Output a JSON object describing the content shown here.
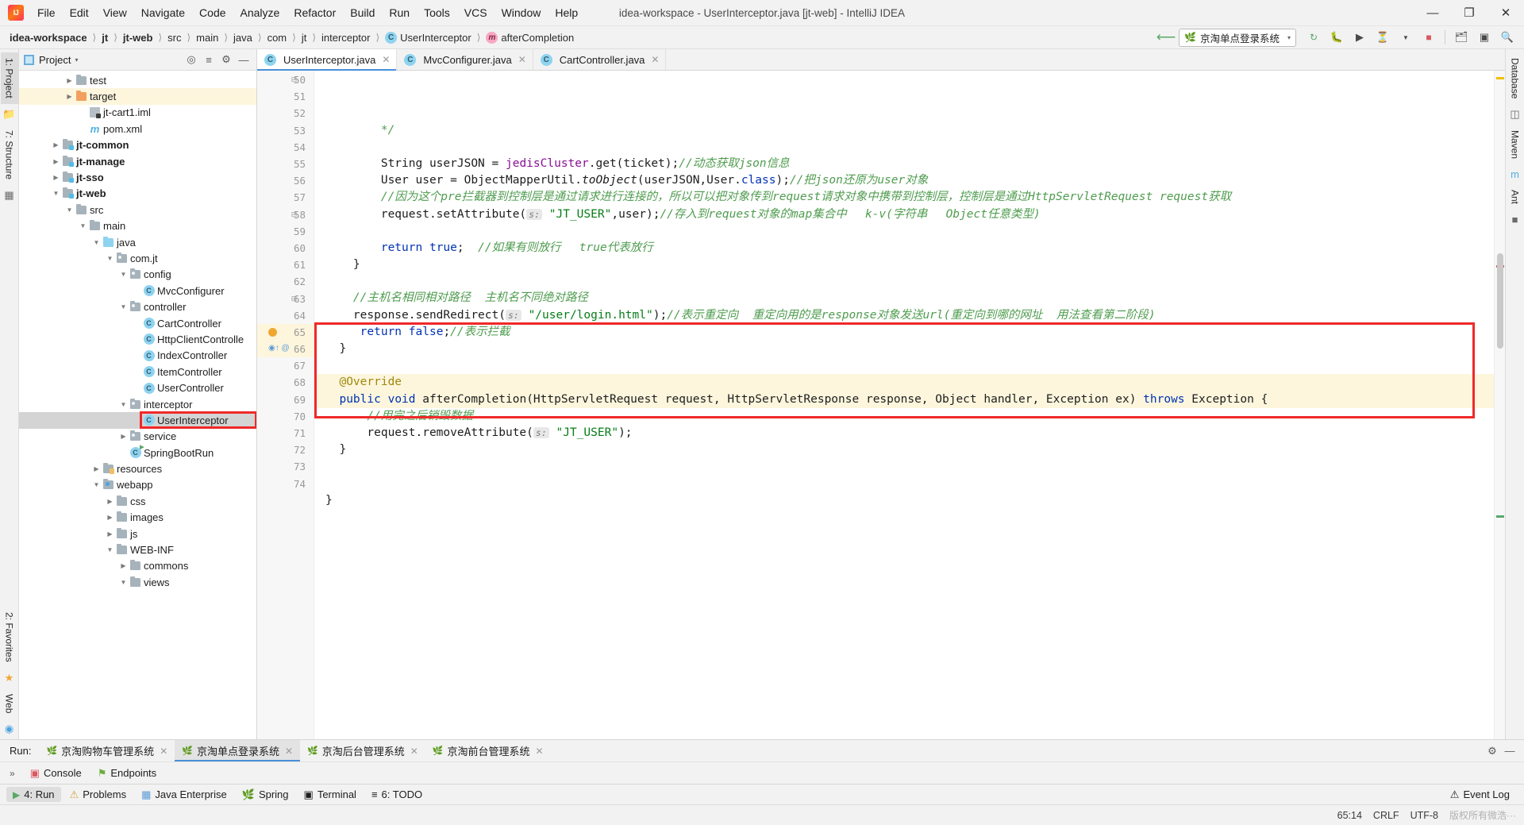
{
  "window": {
    "title": "idea-workspace - UserInterceptor.java [jt-web] - IntelliJ IDEA",
    "minimize": "—",
    "maximize": "❐",
    "close": "✕"
  },
  "menu": [
    {
      "label": "File"
    },
    {
      "label": "Edit"
    },
    {
      "label": "View"
    },
    {
      "label": "Navigate"
    },
    {
      "label": "Code"
    },
    {
      "label": "Analyze"
    },
    {
      "label": "Refactor"
    },
    {
      "label": "Build"
    },
    {
      "label": "Run"
    },
    {
      "label": "Tools"
    },
    {
      "label": "VCS"
    },
    {
      "label": "Window"
    },
    {
      "label": "Help"
    }
  ],
  "breadcrumb": [
    {
      "label": "idea-workspace",
      "bold": true,
      "icon": ""
    },
    {
      "label": "jt",
      "bold": true,
      "icon": ""
    },
    {
      "label": "jt-web",
      "bold": true,
      "icon": ""
    },
    {
      "label": "src",
      "bold": false,
      "icon": ""
    },
    {
      "label": "main",
      "bold": false,
      "icon": ""
    },
    {
      "label": "java",
      "bold": false,
      "icon": ""
    },
    {
      "label": "com",
      "bold": false,
      "icon": ""
    },
    {
      "label": "jt",
      "bold": false,
      "icon": ""
    },
    {
      "label": "interceptor",
      "bold": false,
      "icon": ""
    },
    {
      "label": "UserInterceptor",
      "bold": false,
      "icon": "class-icon"
    },
    {
      "label": "afterCompletion",
      "bold": false,
      "icon": "method-icon"
    }
  ],
  "toolbar": {
    "run_config": "京淘单点登录系统",
    "run_config_caret": "▾",
    "icons": [
      "build-icon",
      "run-icon",
      "debug-icon",
      "coverage-icon",
      "profiler-icon",
      "stop-icon",
      "project-structure-icon",
      "terminal-icon",
      "search-everywhere-icon"
    ]
  },
  "project_panel": {
    "title": "Project",
    "caret": "▾",
    "actions": [
      "locate-icon",
      "collapse-all-icon",
      "settings-icon",
      "hide-icon"
    ],
    "tree": [
      {
        "label": "test",
        "depth": 3,
        "twisty": "▶",
        "icon": "folder",
        "bold": false,
        "state": ""
      },
      {
        "label": "target",
        "depth": 3,
        "twisty": "▶",
        "icon": "folder-orange",
        "bold": false,
        "state": "hl"
      },
      {
        "label": "jt-cart1.iml",
        "depth": 4,
        "twisty": "",
        "icon": "iml",
        "bold": false,
        "state": ""
      },
      {
        "label": "pom.xml",
        "depth": 4,
        "twisty": "",
        "icon": "maven",
        "bold": false,
        "state": ""
      },
      {
        "label": "jt-common",
        "depth": 2,
        "twisty": "▶",
        "icon": "module",
        "bold": true,
        "state": ""
      },
      {
        "label": "jt-manage",
        "depth": 2,
        "twisty": "▶",
        "icon": "module",
        "bold": true,
        "state": ""
      },
      {
        "label": "jt-sso",
        "depth": 2,
        "twisty": "▶",
        "icon": "module",
        "bold": true,
        "state": ""
      },
      {
        "label": "jt-web",
        "depth": 2,
        "twisty": "▼",
        "icon": "module",
        "bold": true,
        "state": ""
      },
      {
        "label": "src",
        "depth": 3,
        "twisty": "▼",
        "icon": "folder",
        "bold": false,
        "state": ""
      },
      {
        "label": "main",
        "depth": 4,
        "twisty": "▼",
        "icon": "folder",
        "bold": false,
        "state": ""
      },
      {
        "label": "java",
        "depth": 5,
        "twisty": "▼",
        "icon": "folder-blue",
        "bold": false,
        "state": ""
      },
      {
        "label": "com.jt",
        "depth": 6,
        "twisty": "▼",
        "icon": "package",
        "bold": false,
        "state": ""
      },
      {
        "label": "config",
        "depth": 7,
        "twisty": "▼",
        "icon": "package",
        "bold": false,
        "state": ""
      },
      {
        "label": "MvcConfigurer",
        "depth": 8,
        "twisty": "",
        "icon": "class",
        "bold": false,
        "state": ""
      },
      {
        "label": "controller",
        "depth": 7,
        "twisty": "▼",
        "icon": "package",
        "bold": false,
        "state": ""
      },
      {
        "label": "CartController",
        "depth": 8,
        "twisty": "",
        "icon": "class",
        "bold": false,
        "state": ""
      },
      {
        "label": "HttpClientControlle",
        "depth": 8,
        "twisty": "",
        "icon": "class",
        "bold": false,
        "state": ""
      },
      {
        "label": "IndexController",
        "depth": 8,
        "twisty": "",
        "icon": "class",
        "bold": false,
        "state": ""
      },
      {
        "label": "ItemController",
        "depth": 8,
        "twisty": "",
        "icon": "class",
        "bold": false,
        "state": ""
      },
      {
        "label": "UserController",
        "depth": 8,
        "twisty": "",
        "icon": "class",
        "bold": false,
        "state": ""
      },
      {
        "label": "interceptor",
        "depth": 7,
        "twisty": "▼",
        "icon": "package",
        "bold": false,
        "state": ""
      },
      {
        "label": "UserInterceptor",
        "depth": 8,
        "twisty": "",
        "icon": "class",
        "bold": false,
        "state": "sel"
      },
      {
        "label": "service",
        "depth": 7,
        "twisty": "▶",
        "icon": "package",
        "bold": false,
        "state": ""
      },
      {
        "label": "SpringBootRun",
        "depth": 7,
        "twisty": "",
        "icon": "class-run",
        "bold": false,
        "state": ""
      },
      {
        "label": "resources",
        "depth": 5,
        "twisty": "▶",
        "icon": "folder-res",
        "bold": false,
        "state": ""
      },
      {
        "label": "webapp",
        "depth": 5,
        "twisty": "▼",
        "icon": "folder-web",
        "bold": false,
        "state": ""
      },
      {
        "label": "css",
        "depth": 6,
        "twisty": "▶",
        "icon": "folder",
        "bold": false,
        "state": ""
      },
      {
        "label": "images",
        "depth": 6,
        "twisty": "▶",
        "icon": "folder",
        "bold": false,
        "state": ""
      },
      {
        "label": "js",
        "depth": 6,
        "twisty": "▶",
        "icon": "folder",
        "bold": false,
        "state": ""
      },
      {
        "label": "WEB-INF",
        "depth": 6,
        "twisty": "▼",
        "icon": "folder",
        "bold": false,
        "state": ""
      },
      {
        "label": "commons",
        "depth": 7,
        "twisty": "▶",
        "icon": "folder",
        "bold": false,
        "state": ""
      },
      {
        "label": "views",
        "depth": 7,
        "twisty": "▼",
        "icon": "folder",
        "bold": false,
        "state": ""
      }
    ]
  },
  "left_strip": {
    "tabs": [
      "1: Project",
      "7: Structure"
    ],
    "bottom_tabs": [
      "2: Favorites",
      "Web"
    ]
  },
  "right_strip": {
    "tabs": [
      "Database",
      "m",
      "Maven",
      "Ant"
    ]
  },
  "editor_tabs": [
    {
      "label": "UserInterceptor.java",
      "active": true,
      "close": "✕"
    },
    {
      "label": "MvcConfigurer.java",
      "active": false,
      "close": "✕"
    },
    {
      "label": "CartController.java",
      "active": false,
      "close": "✕"
    }
  ],
  "code": {
    "first_line": 50,
    "lines": [
      {
        "n": 50,
        "html": "        <span class='cm'>*/</span>",
        "hl": false,
        "fold": true
      },
      {
        "n": 51,
        "html": "",
        "hl": false
      },
      {
        "n": 52,
        "html": "        String userJSON = <span class='fld'>jedisCluster</span>.get(ticket);<span class='cm'>//动态获取json信息</span>",
        "hl": false
      },
      {
        "n": 53,
        "html": "        User user = ObjectMapperUtil.<span class='mtd'>toObject</span>(userJSON,User.<span class='kw'>class</span>);<span class='cm'>//把json还原为user对象</span>",
        "hl": false
      },
      {
        "n": 54,
        "html": "        <span class='cm'>//因为这个pre拦截器到控制层是通过请求进行连接的，所以可以把对象传到request请求对象中携带到控制层，控制层是通过HttpServletRequest request获取</span>",
        "hl": false
      },
      {
        "n": 55,
        "html": "        request.setAttribute(<span class='hint'>s:</span> <span class='str'>\"JT_USER\"</span>,user);<span class='cm'>//存入到request对象的map集合中　 k-v(字符串　 Object任意类型)</span>",
        "hl": false
      },
      {
        "n": 56,
        "html": "",
        "hl": false
      },
      {
        "n": 57,
        "html": "        <span class='kw'>return</span> <span class='kw'>true</span>;  <span class='cm'>//如果有则放行　 true代表放行</span>",
        "hl": false
      },
      {
        "n": 58,
        "html": "    }",
        "hl": false,
        "fold": true
      },
      {
        "n": 59,
        "html": "",
        "hl": false
      },
      {
        "n": 60,
        "html": "    <span class='cm'>//主机名相同相对路径  主机名不同绝对路径</span>",
        "hl": false
      },
      {
        "n": 61,
        "html": "    response.sendRedirect(<span class='hint'>s:</span> <span class='str'>\"/user/login.html\"</span>);<span class='cm'>//表示重定向  重定向用的是response对象发送url(重定向到哪的网址  用法查看第二阶段)</span>",
        "hl": false
      },
      {
        "n": 62,
        "html": "     <span class='kw'>return</span> <span class='kw'>false</span>;<span class='cm'>//表示拦截</span>",
        "hl": false
      },
      {
        "n": 63,
        "html": "  }",
        "hl": false,
        "fold": true
      },
      {
        "n": 64,
        "html": "",
        "hl": false
      },
      {
        "n": 65,
        "html": "  <span class='ann'>@Override</span>",
        "hl": true,
        "bulb": true
      },
      {
        "n": 66,
        "html": "  <span class='kw'>public</span> <span class='kw'>void</span> <span class='mtd2'>afterCompletion</span>(HttpServletRequest request, HttpServletResponse response, Object handler, Exception ex) <span class='kw'>throws</span> Exception {",
        "hl": true,
        "breakpoint": true
      },
      {
        "n": 67,
        "html": "      <span class='cm'>//用完之后销毁数据</span>",
        "hl": false
      },
      {
        "n": 68,
        "html": "      request.removeAttribute(<span class='hint'>s:</span> <span class='str'>\"JT_USER\"</span>);",
        "hl": false
      },
      {
        "n": 69,
        "html": "  }",
        "hl": false
      },
      {
        "n": 70,
        "html": "",
        "hl": false
      },
      {
        "n": 71,
        "html": "",
        "hl": false
      },
      {
        "n": 72,
        "html": "}",
        "hl": false
      },
      {
        "n": 73,
        "html": "",
        "hl": false
      },
      {
        "n": 74,
        "html": "",
        "hl": false
      }
    ]
  },
  "run_panel": {
    "label": "Run:",
    "tabs": [
      {
        "label": "京淘购物车管理系统",
        "active": false,
        "close": "✕"
      },
      {
        "label": "京淘单点登录系统",
        "active": true,
        "close": "✕"
      },
      {
        "label": "京淘后台管理系统",
        "active": false,
        "close": "✕"
      },
      {
        "label": "京淘前台管理系统",
        "active": false,
        "close": "✕"
      }
    ],
    "actions": [
      "settings-icon",
      "hide-icon"
    ],
    "sub_chevron": "»",
    "sub_tabs": [
      {
        "label": "Console",
        "icon": "console-icon",
        "active": false
      },
      {
        "label": "Endpoints",
        "icon": "endpoints-icon",
        "active": false
      }
    ]
  },
  "bottom_strip": {
    "items": [
      {
        "label": "4: Run",
        "icon": "run-icon",
        "active": true
      },
      {
        "label": "Problems",
        "icon": "warning-icon",
        "active": false
      },
      {
        "label": "Java Enterprise",
        "icon": "java-ee-icon",
        "active": false
      },
      {
        "label": "Spring",
        "icon": "spring-icon",
        "active": false
      },
      {
        "label": "Terminal",
        "icon": "terminal-icon",
        "active": false
      },
      {
        "label": "6: TODO",
        "icon": "todo-icon",
        "active": false
      }
    ],
    "right": [
      {
        "label": "Event Log",
        "icon": "event-log-icon"
      }
    ]
  },
  "statusbar": {
    "caret_position": "65:14",
    "line_separator": "CRLF",
    "encoding": "UTF-8",
    "watermark": "版权所有微浩···"
  },
  "colors": {
    "accent": "#4a90d9",
    "annotation_red": "#ef2929",
    "comment_green": "#4f9c4f",
    "keyword_blue": "#0033b3",
    "string_green": "#067d17",
    "field_purple": "#871094",
    "highlight_yellow": "#fdf6dd",
    "selection_gray": "#d4d4d4"
  }
}
